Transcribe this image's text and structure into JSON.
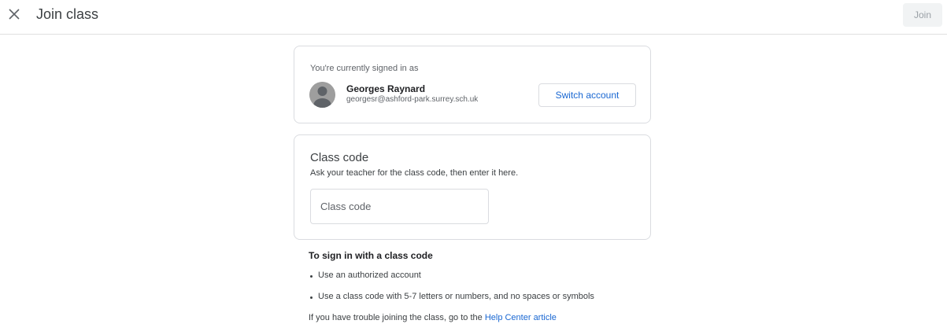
{
  "header": {
    "title": "Join class",
    "join_label": "Join"
  },
  "account": {
    "signed_in_label": "You're currently signed in as",
    "name": "Georges Raynard",
    "email": "georgesr@ashford-park.surrey.sch.uk",
    "switch_label": "Switch account"
  },
  "class_code": {
    "title": "Class code",
    "description": "Ask your teacher for the class code, then enter it here.",
    "input_placeholder": "Class code",
    "input_value": ""
  },
  "help": {
    "title": "To sign in with a class code",
    "bullets": [
      "Use an authorized account",
      "Use a class code with 5-7 letters or numbers, and no spaces or symbols"
    ],
    "trouble_prefix": "If you have trouble joining the class, go to the ",
    "trouble_link": "Help Center article"
  },
  "icons": {
    "close": "close-icon",
    "avatar": "default-avatar-icon"
  },
  "colors": {
    "link": "#1967d2",
    "border": "#dadce0",
    "join_bg": "#f1f3f4",
    "join_text": "#9aa0a6"
  }
}
